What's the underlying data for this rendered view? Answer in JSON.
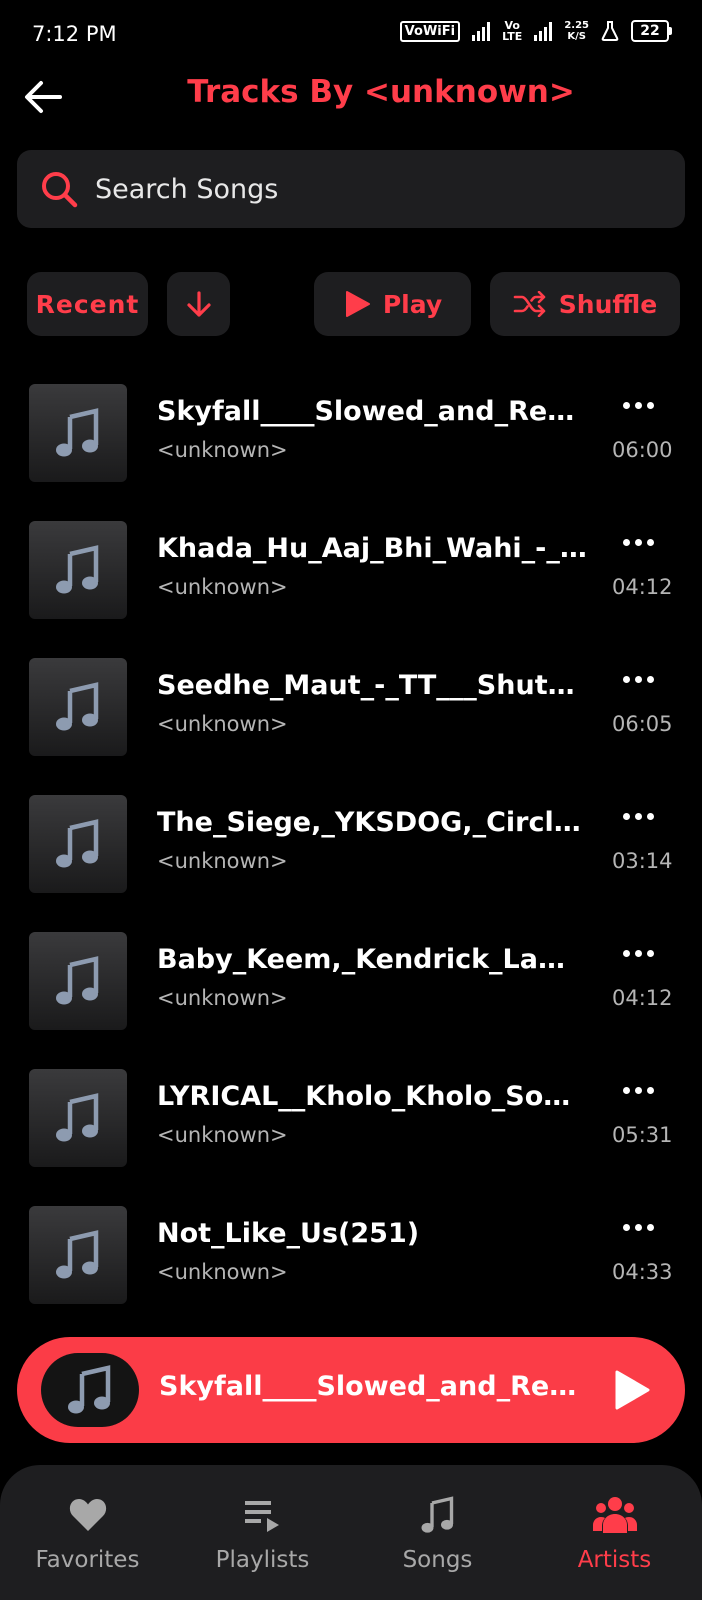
{
  "status_bar": {
    "time": "7:12 PM",
    "vowifi": "VoWiFi",
    "volte_top": "Vo",
    "volte_bottom": "LTE",
    "net_speed_value": "2.25",
    "net_speed_unit": "K/S",
    "battery": "22"
  },
  "header": {
    "title": "Tracks By <unknown>"
  },
  "search": {
    "placeholder": "Search Songs"
  },
  "controls": {
    "sort_label": "Recent",
    "play_label": "Play",
    "shuffle_label": "Shuffle"
  },
  "tracks": [
    {
      "title": "Skyfall____Slowed_and_Reverb",
      "artist": "<unknown>",
      "duration": "06:00"
    },
    {
      "title": "Khada_Hu_Aaj_Bhi_Wahi_-_Slowed",
      "artist": "<unknown>",
      "duration": "04:12"
    },
    {
      "title": "Seedhe_Maut_-_TT___Shutdown",
      "artist": "<unknown>",
      "duration": "06:05"
    },
    {
      "title": "The_Siege,_YKSDOG,_Circle_Tower",
      "artist": "<unknown>",
      "duration": "03:14"
    },
    {
      "title": "Baby_Keem,_Kendrick_Lamar_-_Family",
      "artist": "<unknown>",
      "duration": "04:12"
    },
    {
      "title": "LYRICAL__Kholo_Kholo_Song_Taare",
      "artist": "<unknown>",
      "duration": "05:31"
    },
    {
      "title": "Not_Like_Us(251)",
      "artist": "<unknown>",
      "duration": "04:33"
    }
  ],
  "mini_player": {
    "title": "Skyfall____Slowed_and_Reverb"
  },
  "bottom_nav": [
    {
      "label": "Favorites",
      "icon": "heart-icon"
    },
    {
      "label": "Playlists",
      "icon": "playlist-icon"
    },
    {
      "label": "Songs",
      "icon": "music-note-icon"
    },
    {
      "label": "Artists",
      "icon": "people-icon",
      "active": true
    }
  ],
  "colors": {
    "accent": "#ff3d4a",
    "mini_player_bg": "#fb3c47",
    "surface": "#1e1e20",
    "background": "#000000",
    "secondary_text": "#b5b5b5"
  }
}
